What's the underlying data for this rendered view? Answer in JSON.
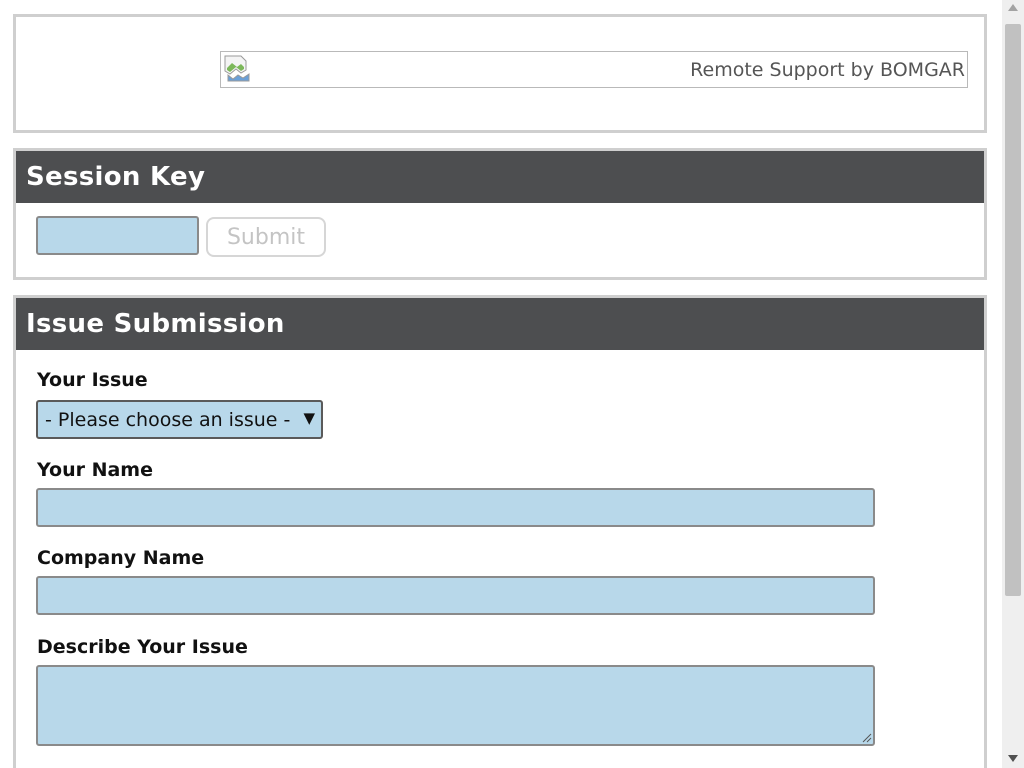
{
  "header": {
    "logo_alt": "Remote Support by BOMGAR"
  },
  "session_key": {
    "title": "Session Key",
    "input_value": "",
    "submit_label": "Submit"
  },
  "issue_submission": {
    "title": "Issue Submission",
    "issue_label": "Your Issue",
    "issue_selected": "- Please choose an issue -",
    "name_label": "Your Name",
    "name_value": "",
    "company_label": "Company Name",
    "company_value": "",
    "describe_label": "Describe Your Issue",
    "describe_value": ""
  },
  "colors": {
    "title_bar": "#4d4e50",
    "input_fill": "#b8d8ea",
    "panel_border": "#cfcfcf"
  },
  "icons": [
    "broken-image-icon",
    "dropdown-arrow-icon",
    "resize-grip-icon",
    "scroll-up-icon",
    "scroll-down-icon"
  ]
}
